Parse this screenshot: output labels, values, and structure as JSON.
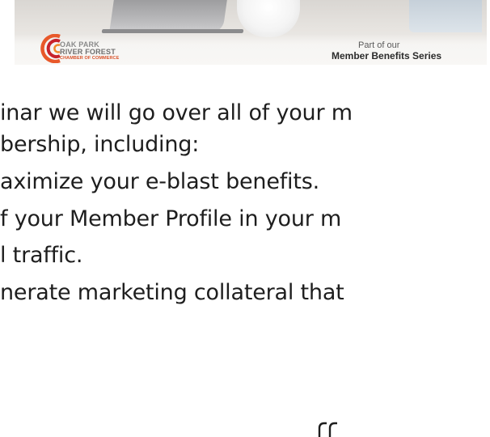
{
  "banner": {
    "logo": {
      "line1": "OAK PARK",
      "line2": "RIVER FOREST",
      "line3": "CHAMBER OF COMMERCE"
    },
    "series_sub": "Part of our",
    "series_title": "Member Benefits Series"
  },
  "body": {
    "lines": [
      "inar we will go over all of your m",
      "bership, including:",
      "aximize your e-blast benefits.",
      "f your Member Profile in your m",
      "l traffic.",
      "nerate marketing collateral that"
    ]
  },
  "colors": {
    "logo_orange": "#e8582a",
    "logo_red": "#c8232c",
    "text": "#1e1e1e"
  }
}
